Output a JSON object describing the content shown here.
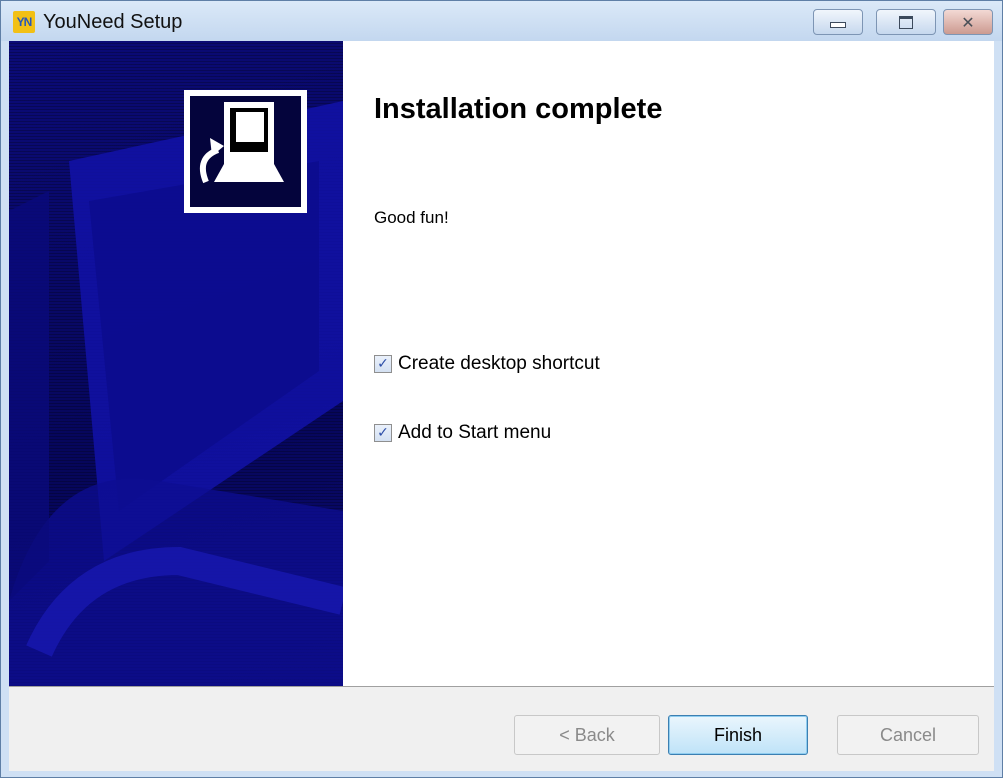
{
  "window": {
    "title": "YouNeed Setup",
    "icon": "youneed-app-icon",
    "app_icon_text": "YN"
  },
  "banner": {
    "icon": "computer-setup-icon"
  },
  "content": {
    "heading": "Installation complete",
    "message": "Good fun!",
    "options": [
      {
        "label": "Create desktop shortcut",
        "checked": true
      },
      {
        "label": "Add to Start menu",
        "checked": true
      }
    ]
  },
  "buttons": {
    "back": "< Back",
    "finish": "Finish",
    "cancel": "Cancel"
  },
  "colors": {
    "banner": "#080868",
    "accent": "#3c7fb1"
  }
}
